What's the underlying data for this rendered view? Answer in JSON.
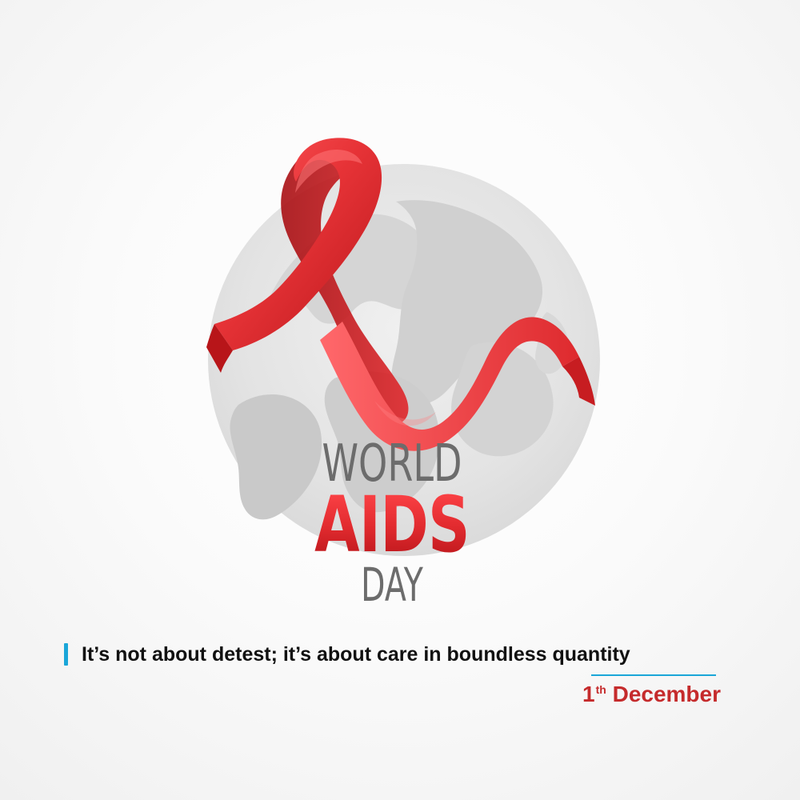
{
  "poster": {
    "title_world": "WORLD",
    "title_aids": "AIDS",
    "title_day": "DAY",
    "tagline": "It’s not about detest; it’s about care in boundless quantity",
    "date_day": "1",
    "date_suffix": "th",
    "date_month": "December"
  },
  "colors": {
    "ribbon": "#d62b2e",
    "aids_text": "#cc2327",
    "accent_blue": "#1aa6d8",
    "globe": "#e3e3e3",
    "text_dark": "#111111",
    "text_gray": "#6c6c6c"
  },
  "icons": {
    "ribbon": "awareness-ribbon",
    "globe": "world-globe"
  }
}
